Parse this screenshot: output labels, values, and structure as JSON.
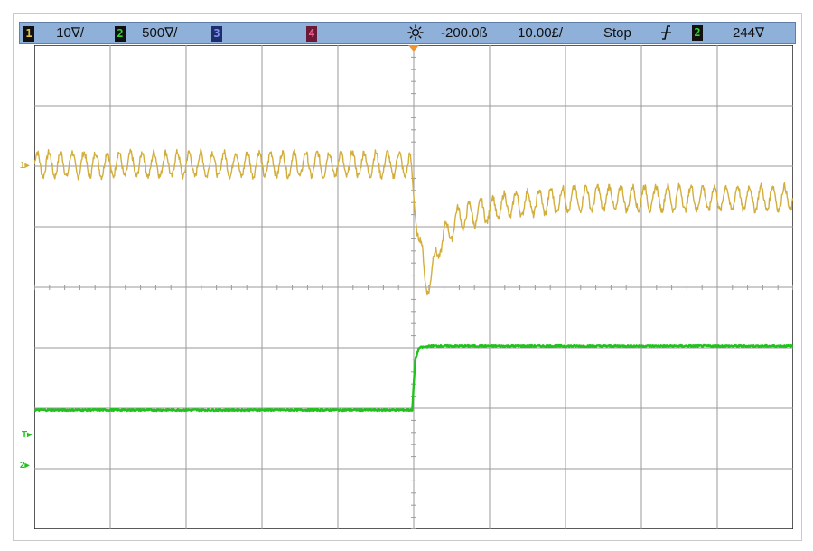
{
  "status_bar": {
    "ch1": {
      "badge": "1",
      "scale": "10∇/",
      "color": "#e3c04a"
    },
    "ch2": {
      "badge": "2",
      "scale": "500∇/",
      "color": "#32d432"
    },
    "ch3": {
      "badge": "3",
      "color": "#7d96ee"
    },
    "ch4": {
      "badge": "4",
      "color": "#ef5c92"
    },
    "acquisition_icon": "sun-icon",
    "time_position": "-200.0ß",
    "time_scale": "10.00£/",
    "run_state": "Stop",
    "trigger_slope_icon": "trigger-slope-icon",
    "trigger_source_badge": "2",
    "trigger_level": "244∇"
  },
  "markers": {
    "ch1_ground": "1▸",
    "ch2_ground": "2▸",
    "trigger_level": "T▸"
  },
  "colors": {
    "ch1_trace": "#d3ae3c",
    "ch2_trace": "#22c21e",
    "grid": "#9a9a9a",
    "statusbar": "#8fb0d8",
    "trigger_point": "#f0962c"
  },
  "graticule": {
    "h_divisions": 10,
    "v_divisions": 8,
    "minor_ticks_per_division": 5
  },
  "chart_data": {
    "type": "line",
    "x_units": "divisions",
    "y_units": "divisions",
    "xlim": [
      0,
      10
    ],
    "ylim": [
      -4,
      4
    ],
    "series": [
      {
        "channel": "1",
        "color": "#d3ae3c",
        "ripple_amplitude_div": 0.2,
        "ripple_cycles_per_div": 6.5,
        "points": [
          [
            0,
            2.03
          ],
          [
            4.95,
            2.03
          ],
          [
            5.02,
            1.3
          ],
          [
            5.1,
            0.6
          ],
          [
            5.15,
            0.05
          ],
          [
            5.22,
            0.15
          ],
          [
            5.35,
            0.75
          ],
          [
            5.6,
            1.15
          ],
          [
            6.2,
            1.35
          ],
          [
            7.2,
            1.47
          ],
          [
            10,
            1.47
          ]
        ]
      },
      {
        "channel": "2",
        "color": "#22c21e",
        "ripple_amplitude_div": 0.03,
        "ripple_cycles_per_div": 0,
        "points": [
          [
            0,
            -2.03
          ],
          [
            4.98,
            -2.03
          ],
          [
            5.02,
            -1.2
          ],
          [
            5.07,
            -1.0
          ],
          [
            5.22,
            -0.97
          ],
          [
            10,
            -0.97
          ]
        ]
      }
    ]
  }
}
